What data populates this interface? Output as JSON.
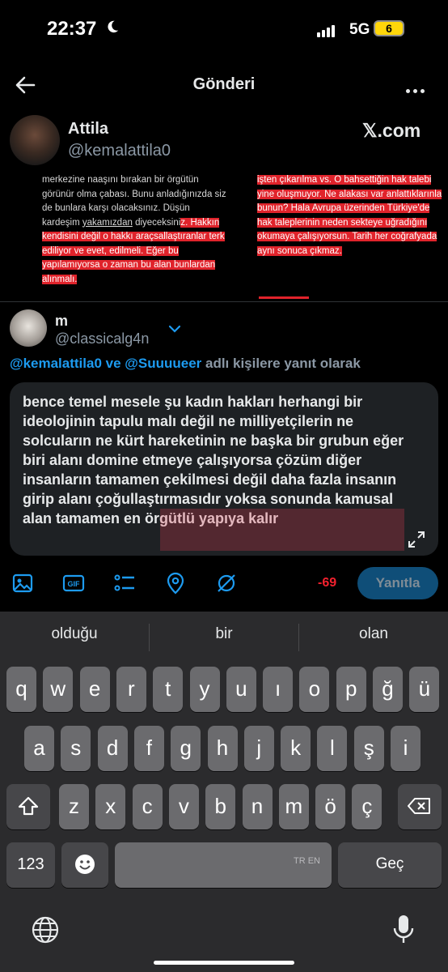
{
  "status": {
    "time": "22:37",
    "network": "5G",
    "battery": "6"
  },
  "header": {
    "title": "Gönderi"
  },
  "quoted": {
    "name": "Attila",
    "handle": "@kemalattila0",
    "brand": "𝕏.com",
    "left_text": {
      "plain1": "merkezine naaşını bırakan bir örgütün görünür olma çabası. Bunu anladığınızda siz de bunlara karşı olacaksınız. Düşün kardeşim ",
      "underline": "yakamızdan",
      "plain2": " diyeceksini",
      "highlight": "z. Hakkın kendisini değil o hakkı araçsallaştıranlar terk ediliyor ve evet, edilmeli. Eğer bu yapılamıyorsa o zaman bu alan bunlardan alınmalı."
    },
    "right_text": {
      "highlight": "işten çıkarılma vs. O bahsettiğin hak talebi yine oluşmuyor. Ne alakası var anlattıklarınla bunun? Hala Avrupa üzerinden Türkiye'de hak taleplerinin neden sekteye uğradığını okumaya çalışıyorsun. Tarih her coğrafyada aynı sonuca çıkmaz."
    }
  },
  "composer": {
    "name": "m",
    "handle": "@classicalg4n",
    "reply_to": {
      "mention1": "@kemalattila0",
      "and": " ve ",
      "mention2": "@Suuuueer",
      "suffix": " adlı kişilere yanıt olarak"
    },
    "text": "bence temel mesele şu kadın hakları herhangi bir ideolojinin tapulu malı değil ne milliyetçilerin ne solcuların ne kürt hareketinin ne başka bir grubun eğer biri alanı domine etmeye çalışıyorsa çözüm diğer insanların tamamen çekilmesi değil daha fazla insanın girip alanı çoğullaştırmasıdır yoksa sonunda kamusal alan tamamen en örgütlü yapıya kalır",
    "char_count": "-69",
    "submit_label": "Yanıtla",
    "toolbar_icons": [
      "image-icon",
      "gif-icon",
      "poll-icon",
      "location-icon",
      "circle-icon"
    ]
  },
  "keyboard": {
    "suggestions": [
      "olduğu",
      "bir",
      "olan"
    ],
    "row1": [
      "q",
      "w",
      "e",
      "r",
      "t",
      "y",
      "u",
      "ı",
      "o",
      "p",
      "ğ",
      "ü"
    ],
    "row2": [
      "a",
      "s",
      "d",
      "f",
      "g",
      "h",
      "j",
      "k",
      "l",
      "ş",
      "i"
    ],
    "row3": [
      "z",
      "x",
      "c",
      "v",
      "b",
      "n",
      "m",
      "ö",
      "ç"
    ],
    "numbers_label": "123",
    "space_lang": "TR EN",
    "return_label": "Geç"
  },
  "colors": {
    "accent": "#1d9bf0",
    "highlight": "#e0232b",
    "count": "#f4212e",
    "button": "#0f4e78"
  }
}
